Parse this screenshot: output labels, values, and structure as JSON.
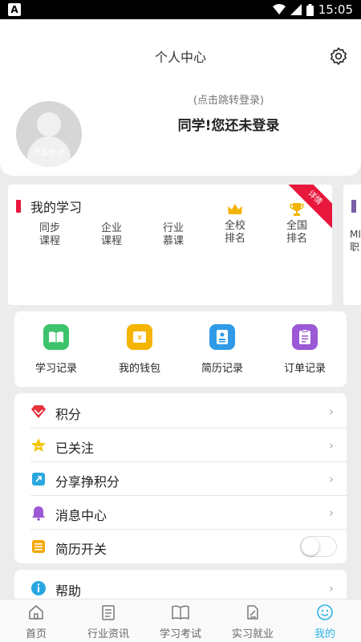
{
  "status_bar": {
    "notification_badge": "A",
    "time": "15:05"
  },
  "header": {
    "title": "个人中心"
  },
  "profile": {
    "avatar_text": "汽车优才",
    "login_hint": "(点击跳转登录)",
    "login_prompt": "同学!您还未登录"
  },
  "my_study": {
    "title": "我的学习",
    "ribbon": "详情",
    "items": [
      {
        "line1": "同步",
        "line2": "课程"
      },
      {
        "line1": "企业",
        "line2": "课程"
      },
      {
        "line1": "行业",
        "line2": "慕课"
      },
      {
        "line1": "全校",
        "line2": "排名",
        "icon": "crown-icon"
      },
      {
        "line1": "全国",
        "line2": "排名",
        "icon": "trophy-icon"
      }
    ]
  },
  "side_card": {
    "line1": "MI",
    "line2": "职"
  },
  "quick_actions": [
    {
      "label": "学习记录",
      "icon": "book-icon",
      "color": "#3cc36b"
    },
    {
      "label": "我的钱包",
      "icon": "wallet-icon",
      "color": "#f5b400"
    },
    {
      "label": "简历记录",
      "icon": "resume-icon",
      "color": "#2f9be8"
    },
    {
      "label": "订单记录",
      "icon": "order-icon",
      "color": "#9b59d6"
    }
  ],
  "menu": [
    {
      "label": "积分",
      "icon": "diamond-icon",
      "color": "#e8323c"
    },
    {
      "label": "已关注",
      "icon": "star-icon",
      "color": "#f5c400"
    },
    {
      "label": "分享挣积分",
      "icon": "share-icon",
      "color": "#2aa7e0"
    },
    {
      "label": "消息中心",
      "icon": "bell-icon",
      "color": "#9b59d6"
    },
    {
      "label": "简历开关",
      "icon": "list-icon",
      "color": "#f5a800"
    }
  ],
  "help": {
    "label": "帮助",
    "icon": "info-icon",
    "color": "#2aa7e0"
  },
  "tabs": [
    {
      "label": "首页",
      "icon": "home-icon"
    },
    {
      "label": "行业资讯",
      "icon": "news-icon"
    },
    {
      "label": "学习考试",
      "icon": "exam-icon"
    },
    {
      "label": "实习就业",
      "icon": "job-icon"
    },
    {
      "label": "我的",
      "icon": "profile-icon",
      "active": true
    }
  ],
  "colors": {
    "accent_red": "#e8173c",
    "tab_active": "#2bb3e3"
  }
}
